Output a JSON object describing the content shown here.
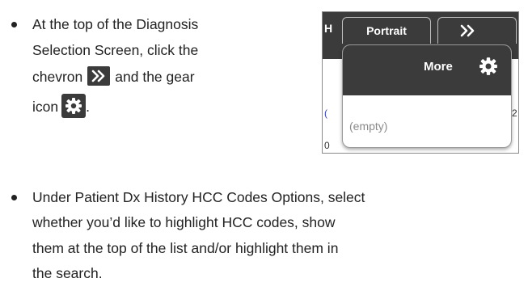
{
  "step1": {
    "line1": "At the top of the Diagnosis",
    "line2": "Selection Screen, click the",
    "line3_before": "chevron",
    "line3_after": "and the gear",
    "line4": "icon",
    "line4_after": "."
  },
  "screenshot": {
    "tab_h": "H",
    "tab_portrait": "Portrait",
    "popup_title": "More",
    "popup_empty": "(empty)",
    "stub_left_1": "(",
    "stub_left_2": "0",
    "stub_right": "2"
  },
  "step2": {
    "line1": "Under Patient Dx History HCC Codes Options, select",
    "line2": "whether you’d like to highlight HCC codes, show",
    "line3": "them at the top of the list and/or highlight them in",
    "line4": "the search."
  },
  "icons": [
    "chevron-double-right-icon",
    "gear-icon"
  ],
  "colors": {
    "dark_bar": "#3b3b3b",
    "text": "#222222",
    "muted": "#8a8a8a"
  }
}
